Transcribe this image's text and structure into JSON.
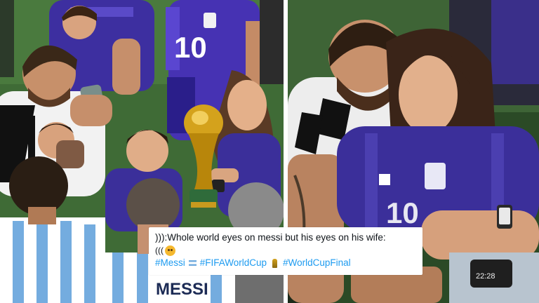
{
  "tweet": {
    "text": "))):Whole world eyes on messi but his eyes on his wife:",
    "emoji_prefix": "(((",
    "hashtags": [
      "#Messi",
      "#FIFAWorldCup",
      "#WorldCupFinal"
    ]
  },
  "photo_text": {
    "left_jersey_number": "10",
    "right_jersey_number": "10",
    "shirt_name": "MESSI",
    "watch_time": "22:28"
  },
  "colors": {
    "argentina_sky_blue": "#74acdf",
    "away_jersey_purple": "#3b2f9a",
    "pitch_green": "#3e6a35",
    "trophy_gold": "#d4a21c",
    "hashtag_blue": "#1d9bf0"
  }
}
